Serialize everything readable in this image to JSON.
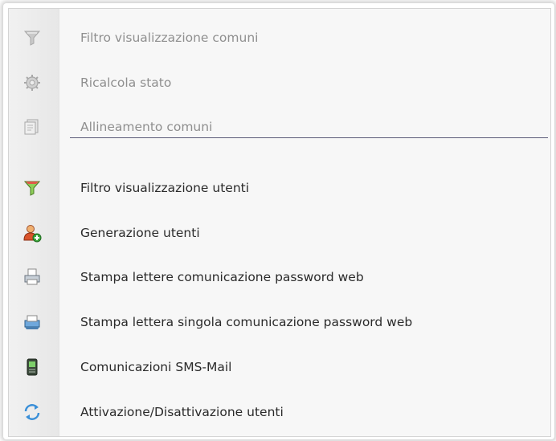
{
  "menu": {
    "items": [
      {
        "label": "Filtro visualizzazione comuni",
        "icon": "funnel-icon",
        "enabled": false
      },
      {
        "label": "Ricalcola stato",
        "icon": "gear-refresh-icon",
        "enabled": false
      },
      {
        "label": "Allineamento comuni",
        "icon": "document-stack-icon",
        "enabled": false
      },
      {
        "label": "Filtro visualizzazione utenti",
        "icon": "funnel-icon",
        "enabled": true
      },
      {
        "label": "Generazione utenti",
        "icon": "user-add-icon",
        "enabled": true
      },
      {
        "label": "Stampa lettere comunicazione password web",
        "icon": "printer-icon",
        "enabled": true
      },
      {
        "label": "Stampa lettera singola comunicazione password web",
        "icon": "printer-single-icon",
        "enabled": true
      },
      {
        "label": "Comunicazioni SMS-Mail",
        "icon": "mobile-phone-icon",
        "enabled": true
      },
      {
        "label": "Attivazione/Disattivazione utenti",
        "icon": "sync-arrows-icon",
        "enabled": true
      }
    ]
  },
  "colors": {
    "text": "#2a2a2a",
    "disabled_text": "#8f8f8f",
    "separator": "#5a5a78",
    "menu_background": "#f7f7f7",
    "gutter": "#ebebeb"
  }
}
